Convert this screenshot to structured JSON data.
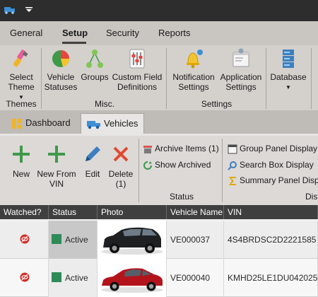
{
  "ribbon_tabs": [
    "General",
    "Setup",
    "Security",
    "Reports"
  ],
  "active_ribbon_tab": "Setup",
  "ribbon": {
    "select_theme": "Select",
    "select_theme_2": "Theme",
    "themes_group": "Themes",
    "vehicle_statuses_1": "Vehicle",
    "vehicle_statuses_2": "Statuses",
    "groups": "Groups",
    "custom_field_1": "Custom Field",
    "custom_field_2": "Definitions",
    "misc_group": "Misc.",
    "notification_1": "Notification",
    "notification_2": "Settings",
    "application_1": "Application",
    "application_2": "Settings",
    "settings_group": "Settings",
    "database": "Database"
  },
  "doc_tabs": [
    "Dashboard",
    "Vehicles"
  ],
  "active_doc_tab": "Vehicles",
  "actions": {
    "new": "New",
    "new_from_vin_1": "New From",
    "new_from_vin_2": "VIN",
    "edit": "Edit",
    "delete_1": "Delete",
    "delete_2": "(1)",
    "archive_items": "Archive Items (1)",
    "show_archived": "Show Archived",
    "status_group": "Status",
    "group_panel_display": "Group Panel Display",
    "search_box_display": "Search Box Display",
    "summary_panel_display": "Summary Panel Displ",
    "display_group": "Dis"
  },
  "grid": {
    "headers": [
      "Watched?",
      "Status",
      "Photo",
      "Vehicle Name",
      "VIN"
    ],
    "rows": [
      {
        "status": "Active",
        "vehicle_name": "VE000037",
        "vin": "4S4BRDSC2D2221585",
        "photo": "black-suv"
      },
      {
        "status": "Active",
        "vehicle_name": "VE000040",
        "vin": "KMHD25LE1DU042025",
        "photo": "red-sedan"
      }
    ]
  },
  "colors": {
    "titlebar": "#2d2d2d",
    "status_active": "#2e8b57",
    "grid_header": "#3f3f3f",
    "watched_icon": "#d0312d"
  }
}
